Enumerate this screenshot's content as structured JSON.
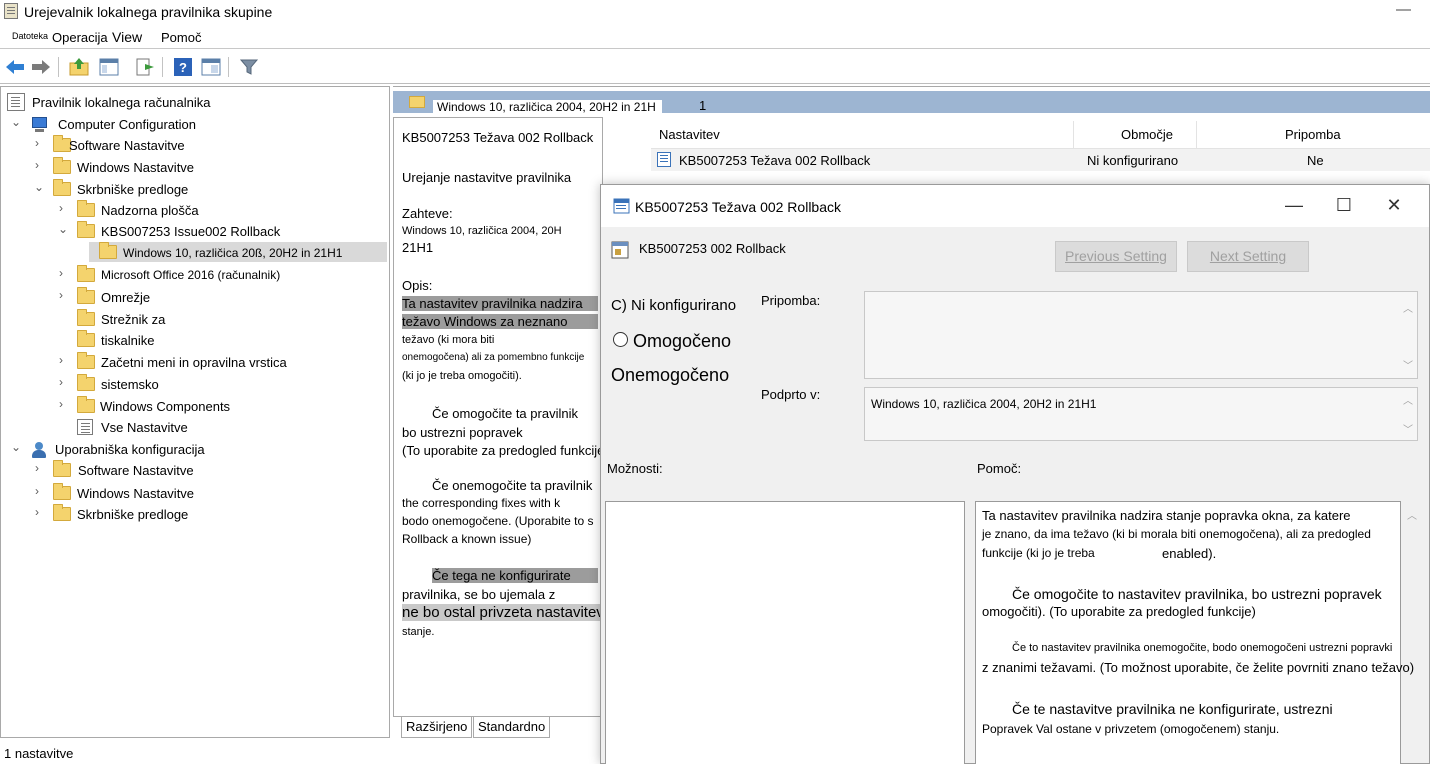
{
  "window": {
    "title": "Urejevalnik lokalnega pravilnika skupine",
    "minimize": "—"
  },
  "menu": [
    "Datoteka",
    "Operacija",
    "View",
    "Pomoč"
  ],
  "tree": {
    "root": "Pravilnik lokalnega računalnika",
    "computer_config": "Computer Configuration",
    "software": "Software Nastavitve",
    "windows_settings": "Windows Nastavitve",
    "admin_templates": "Skrbniške predloge",
    "control_panel": "Nadzorna plošča",
    "kb_folder": "KBS007253 Issue002 Rollback",
    "win10_folder": "Windows 10, različica 20ß, 20H2 in 21H1",
    "office": "Microsoft Office 2016 (računalnik)",
    "network": "Omrežje",
    "printers_line1": "Strežnik za",
    "printers_line2": "tiskalnike",
    "start_menu": "Začetni meni in opravilna vrstica",
    "system": "sistemsko",
    "win_components": "Windows Components",
    "all_settings": "Vse Nastavitve",
    "user_config": "Uporabniška konfiguracija",
    "u_software": "Software Nastavitve",
    "u_windows_settings": "Windows Nastavitve",
    "u_admin_templates": "Skrbniške predloge"
  },
  "right": {
    "header_title": "Windows 10, različica 2004, 20H2 in 21H",
    "header_num": "1",
    "desc": {
      "title": "KB5007253 Težava 002 Rollback",
      "edit": "Urejanje nastavitve pravilnika",
      "req_label": "Zahteve:",
      "req_value1": "Windows 10, različica 2004, 20H",
      "req_value2": "21H1",
      "desc_label": "Opis:",
      "p1_l1": "Ta nastavitev pravilnika nadzira",
      "p1_l2": "težavo Windows za neznano",
      "p1_l3": "težavo (ki mora biti",
      "p1_l4": "onemogočena) ali za pomembno funkcije",
      "p1_l5": "(ki jo je treba omogočiti).",
      "p2_l1": "Če omogočite ta pravilnik",
      "p2_l2": "bo ustrezni popravek",
      "p2_l3": "(To uporabite za predogled funkcije)",
      "p3_l1": "Če onemogočite ta pravilnik",
      "p3_l2": "the corresponding fixes with k",
      "p3_l3": "bodo onemogočene. (Uporabite to s",
      "p3_l4": "Rollback a known issue)",
      "p4_l1": "Če tega ne konfigurirate",
      "p4_l2": "pravilnika, se bo ujemala z",
      "p4_l3": "ne bo ostal privzeta nastavitev Omogoči",
      "p4_l4": "stanje."
    },
    "tabs": [
      "Razširjeno",
      "Standardno"
    ],
    "columns": [
      "Nastavitev",
      "Območje",
      "Pripomba"
    ],
    "row": {
      "setting": "KB5007253 Težava 002 Rollback",
      "state": "Ni konfigurirano",
      "comment": "Ne"
    }
  },
  "status": "1 nastavitve",
  "dialog": {
    "title": "KB5007253 Težava 002 Rollback",
    "subtitle": "KB5007253 002 Rollback",
    "prev": "Previous Setting",
    "next": "Next Setting",
    "opt_not_configured": "C) Ni konfigurirano",
    "opt_enabled": "Omogočeno",
    "opt_disabled": "Onemogočeno",
    "comment_label": "Pripomba:",
    "supported_label": "Podprto v:",
    "supported_value": "Windows 10, različica 2004, 20H2 in 21H1",
    "options_label": "Možnosti:",
    "help_label": "Pomoč:",
    "help": {
      "l1": "Ta nastavitev pravilnika nadzira stanje popravka okna, za katere",
      "l2": "je znano, da ima težavo (ki bi morala biti onemogočena), ali za predogled",
      "l3": "funkcije (ki jo je treba",
      "l3b": "enabled).",
      "l4": "Če omogočite to nastavitev pravilnika, bo ustrezni popravek",
      "l5": "omogočiti). (To uporabite za predogled funkcije)",
      "l6": "Če to nastavitev pravilnika onemogočite, bodo onemogočeni ustrezni popravki",
      "l7": "z znanimi težavami. (To možnost uporabite, če želite povrniti znano težavo)",
      "l8": "Če te nastavitve pravilnika ne konfigurirate, ustrezni",
      "l9": "Popravek Val ostane v privzetem (omogočenem) stanju."
    }
  }
}
